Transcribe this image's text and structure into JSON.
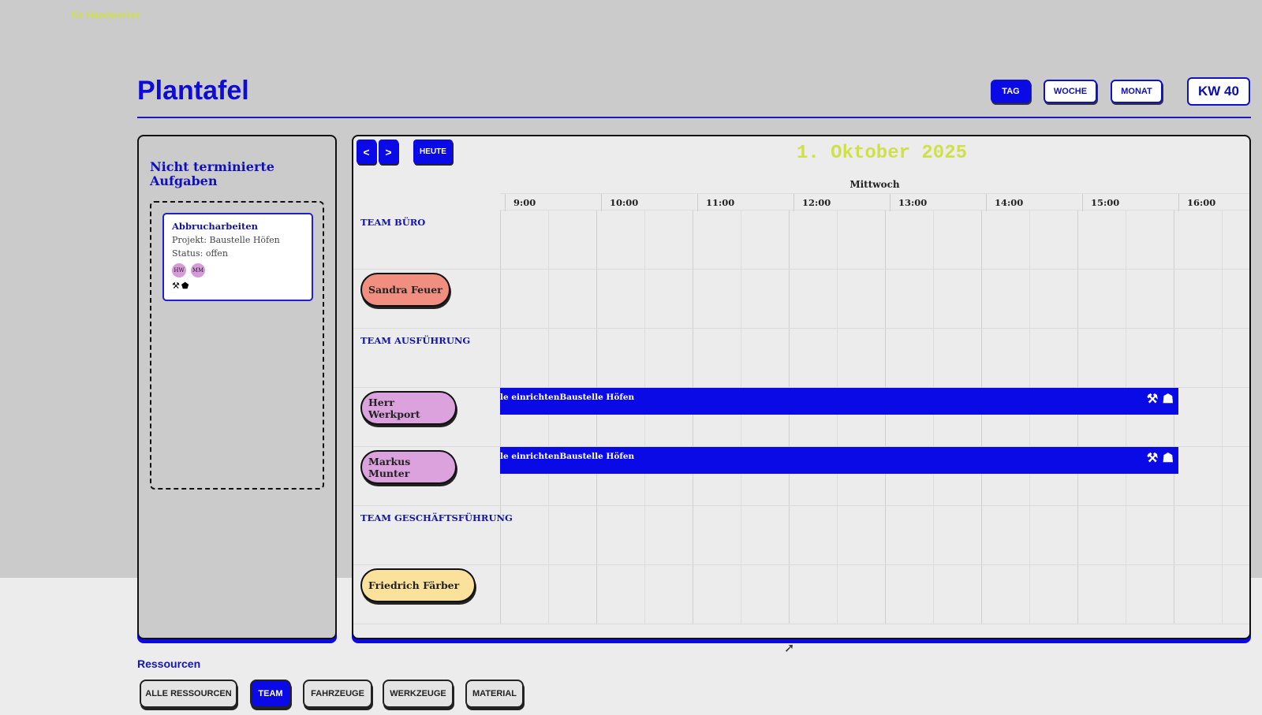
{
  "app": {
    "name": "für Handwerker"
  },
  "header": {
    "title": "Plantafel",
    "views": [
      {
        "label": "TAG",
        "active": true
      },
      {
        "label": "WOCHE",
        "active": false
      },
      {
        "label": "MONAT",
        "active": false
      }
    ],
    "week_badge": "KW 40"
  },
  "unscheduled": {
    "title": "Nicht terminierte Aufgaben",
    "card": {
      "name": "Abbrucharbeiten",
      "project": "Projekt: Baustelle Höfen",
      "status": "Status: offen",
      "avatars": [
        "HW",
        "MM"
      ],
      "tools": [
        "tool-icon",
        "bag-icon"
      ]
    }
  },
  "schedule": {
    "nav_prev": "<",
    "nav_next": ">",
    "today_label": "HEUTE",
    "date_title": "1. Oktober 2025",
    "day_label": "Mittwoch",
    "hours": [
      "9:00",
      "10:00",
      "11:00",
      "12:00",
      "13:00",
      "14:00",
      "15:00",
      "16:00"
    ],
    "rows": [
      {
        "type": "team",
        "label": "TEAM BÜRO"
      },
      {
        "type": "person",
        "label": "Sandra Feuer",
        "color": "#f08e80"
      },
      {
        "type": "team",
        "label": "TEAM AUSFÜHRUNG"
      },
      {
        "type": "person",
        "label": "Herr Werkport",
        "color": "#dba2de",
        "event": "le einrichtenBaustelle Höfen"
      },
      {
        "type": "person",
        "label": "Markus Munter",
        "color": "#dba2de",
        "event": "le einrichtenBaustelle Höfen"
      },
      {
        "type": "team",
        "label": "TEAM GESCHÄFTSFÜHRUNG"
      },
      {
        "type": "person",
        "label": "Friedrich Färber",
        "color": "#fbe29c"
      }
    ]
  },
  "resources": {
    "title": "Ressourcen",
    "filters": [
      {
        "label": "ALLE RESSOURCEN",
        "active": false
      },
      {
        "label": "TEAM",
        "active": true
      },
      {
        "label": "FAHRZEUGE",
        "active": false
      },
      {
        "label": "WERKZEUGE",
        "active": false
      },
      {
        "label": "MATERIAL",
        "active": false
      }
    ]
  },
  "colors": {
    "accent": "#0a0ae6",
    "title_blue": "#0d0dd6",
    "date_yellow": "#cfe04a"
  }
}
